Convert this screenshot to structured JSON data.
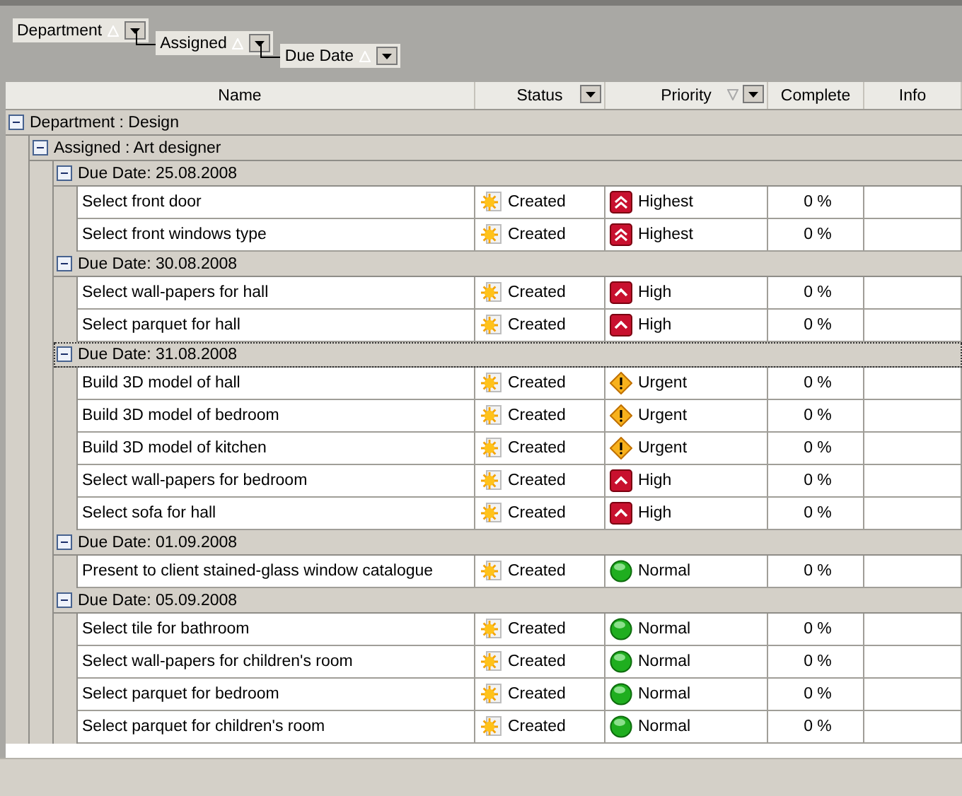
{
  "group_by": [
    {
      "label": "Department",
      "descending": false
    },
    {
      "label": "Assigned",
      "descending": false
    },
    {
      "label": "Due Date",
      "descending": false
    }
  ],
  "columns": [
    {
      "label": "Name",
      "filter": false,
      "sorted": false
    },
    {
      "label": "Status",
      "filter": true,
      "sorted": false
    },
    {
      "label": "Priority",
      "filter": true,
      "sorted": true,
      "descending": true
    },
    {
      "label": "Complete",
      "filter": false,
      "sorted": false
    },
    {
      "label": "Info",
      "filter": false,
      "sorted": false
    }
  ],
  "groups": [
    {
      "label": "Department : Design",
      "expanded": true,
      "focused": false,
      "children": [
        {
          "label": "Assigned : Art designer",
          "expanded": true,
          "focused": false,
          "children": [
            {
              "label": "Due Date: 25.08.2008",
              "expanded": true,
              "focused": false,
              "rows": [
                {
                  "name": "Select front door",
                  "status": "Created",
                  "priority": {
                    "kind": "highest",
                    "label": "Highest"
                  },
                  "complete": "0 %"
                },
                {
                  "name": "Select front windows type",
                  "status": "Created",
                  "priority": {
                    "kind": "highest",
                    "label": "Highest"
                  },
                  "complete": "0 %"
                }
              ]
            },
            {
              "label": "Due Date: 30.08.2008",
              "expanded": true,
              "focused": false,
              "rows": [
                {
                  "name": "Select wall-papers for hall",
                  "status": "Created",
                  "priority": {
                    "kind": "high",
                    "label": "High"
                  },
                  "complete": "0 %"
                },
                {
                  "name": "Select parquet for hall",
                  "status": "Created",
                  "priority": {
                    "kind": "high",
                    "label": "High"
                  },
                  "complete": "0 %"
                }
              ]
            },
            {
              "label": "Due Date: 31.08.2008",
              "expanded": true,
              "focused": true,
              "rows": [
                {
                  "name": "Build 3D model of hall",
                  "status": "Created",
                  "priority": {
                    "kind": "urgent",
                    "label": "Urgent"
                  },
                  "complete": "0 %"
                },
                {
                  "name": "Build 3D model of bedroom",
                  "status": "Created",
                  "priority": {
                    "kind": "urgent",
                    "label": "Urgent"
                  },
                  "complete": "0 %"
                },
                {
                  "name": "Build 3D model of kitchen",
                  "status": "Created",
                  "priority": {
                    "kind": "urgent",
                    "label": "Urgent"
                  },
                  "complete": "0 %"
                },
                {
                  "name": "Select wall-papers for bedroom",
                  "status": "Created",
                  "priority": {
                    "kind": "high",
                    "label": "High"
                  },
                  "complete": "0 %"
                },
                {
                  "name": "Select sofa for hall",
                  "status": "Created",
                  "priority": {
                    "kind": "high",
                    "label": "High"
                  },
                  "complete": "0 %"
                }
              ]
            },
            {
              "label": "Due Date: 01.09.2008",
              "expanded": true,
              "focused": false,
              "rows": [
                {
                  "name": "Present to client stained-glass window catalogue",
                  "status": "Created",
                  "priority": {
                    "kind": "normal",
                    "label": "Normal"
                  },
                  "complete": "0 %"
                }
              ]
            },
            {
              "label": "Due Date: 05.09.2008",
              "expanded": true,
              "focused": false,
              "rows": [
                {
                  "name": "Select tile for bathroom",
                  "status": "Created",
                  "priority": {
                    "kind": "normal",
                    "label": "Normal"
                  },
                  "complete": "0 %"
                },
                {
                  "name": "Select wall-papers for children's room",
                  "status": "Created",
                  "priority": {
                    "kind": "normal",
                    "label": "Normal"
                  },
                  "complete": "0 %"
                },
                {
                  "name": "Select parquet for bedroom",
                  "status": "Created",
                  "priority": {
                    "kind": "normal",
                    "label": "Normal"
                  },
                  "complete": "0 %"
                },
                {
                  "name": "Select parquet for children's room",
                  "status": "Created",
                  "priority": {
                    "kind": "normal",
                    "label": "Normal"
                  },
                  "complete": "0 %"
                }
              ]
            }
          ]
        }
      ]
    }
  ]
}
